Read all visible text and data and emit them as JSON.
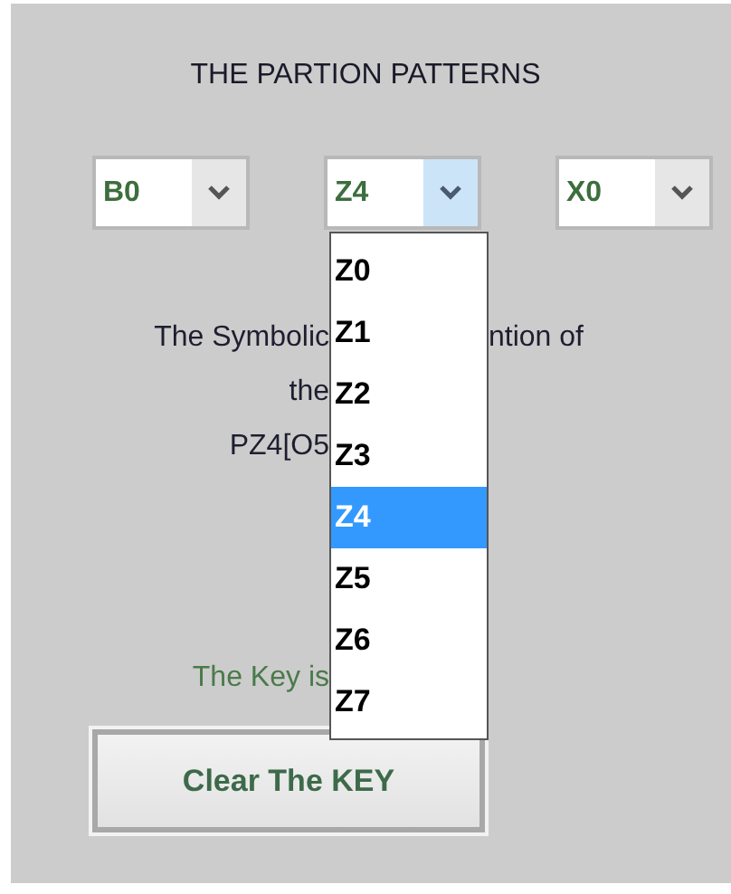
{
  "title": "THE PARTION PATTERNS",
  "dropdowns": [
    {
      "value": "B0",
      "open": false
    },
    {
      "value": "Z4",
      "open": true
    },
    {
      "value": "X0",
      "open": false
    }
  ],
  "dropdown_list": {
    "items": [
      {
        "label": "Z0",
        "selected": false
      },
      {
        "label": "Z1",
        "selected": false
      },
      {
        "label": "Z2",
        "selected": false
      },
      {
        "label": "Z3",
        "selected": false
      },
      {
        "label": "Z4",
        "selected": true
      },
      {
        "label": "Z5",
        "selected": false
      },
      {
        "label": "Z6",
        "selected": false
      },
      {
        "label": "Z7",
        "selected": false
      }
    ]
  },
  "description_lines": [
    {
      "left": "The Symbolic",
      "right": "ntion of"
    },
    {
      "left": "the"
    },
    {
      "left": "PZ4[O5"
    }
  ],
  "key_label": "The Key is",
  "button": "Clear The KEY"
}
